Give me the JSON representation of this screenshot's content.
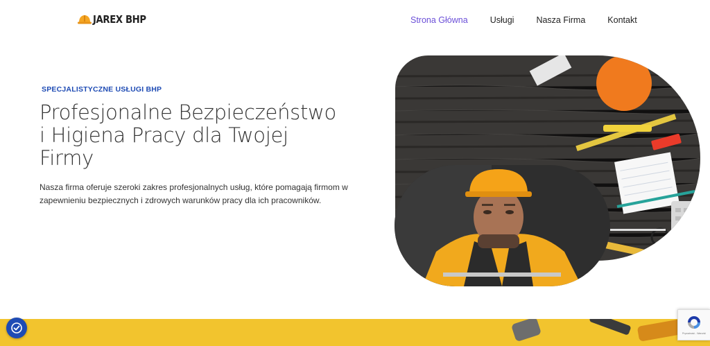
{
  "brand": {
    "logo_text": "JAREX BHP",
    "logo_icon": "hard-hat-icon"
  },
  "nav": {
    "items": [
      {
        "label": "Strona Główna",
        "active": true
      },
      {
        "label": "Usługi",
        "active": false
      },
      {
        "label": "Nasza Firma",
        "active": false
      },
      {
        "label": "Kontakt",
        "active": false
      }
    ]
  },
  "hero": {
    "eyebrow": "SPECJALISTYCZNE USŁUGI BHP",
    "headline": "Profesjonalne Bezpieczeństwo i Higiena Pracy dla Twojej Firmy",
    "lead": "Nasza firma oferuje szeroki zakres profesjonalnych usług, które pomagają firmom w zapewnieniu bezpiecznych i zdrowych warunków pracy dla ich pracowników."
  },
  "widgets": {
    "cookie_icon": "cookie-consent-icon",
    "recaptcha_icon": "recaptcha-icon",
    "recaptcha_text": "Prywatność - Warunki"
  },
  "colors": {
    "accent": "#6b4fd8",
    "eyebrow": "#1e4bb4",
    "strip": "#f2c42e",
    "helmet": "#f5a623"
  }
}
